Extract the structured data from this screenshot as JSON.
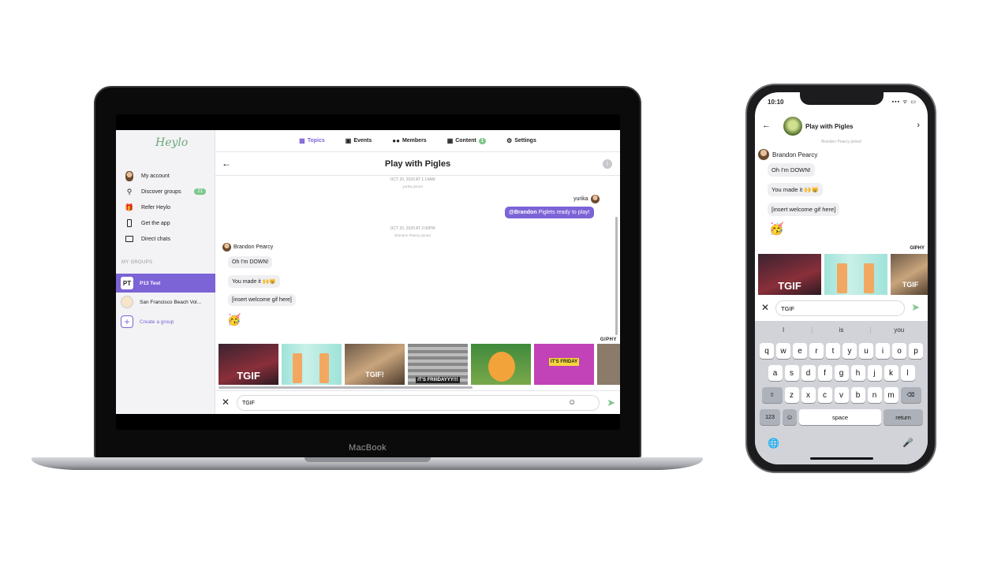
{
  "laptop": {
    "brand_label": "MacBook",
    "app": {
      "logo": "Heylo",
      "sidebar": {
        "items": [
          {
            "label": "My account",
            "icon": "avatar-icon"
          },
          {
            "label": "Discover groups",
            "icon": "search-icon",
            "badge": "21"
          },
          {
            "label": "Refer Heylo",
            "icon": "gift-icon"
          },
          {
            "label": "Get the app",
            "icon": "phone-icon"
          },
          {
            "label": "Direct chats",
            "icon": "chat-icon"
          }
        ],
        "groups_heading": "MY GROUPS",
        "groups": [
          {
            "initials": "PT",
            "label": "P13 Test",
            "active": true
          },
          {
            "label": "San Francisco Beach Vol...",
            "active": false
          },
          {
            "label": "Create a group",
            "active": false
          }
        ]
      },
      "tabs": [
        {
          "label": "Topics",
          "icon": "chat-bubble-icon",
          "active": true
        },
        {
          "label": "Events",
          "icon": "calendar-icon"
        },
        {
          "label": "Members",
          "icon": "people-icon"
        },
        {
          "label": "Content",
          "icon": "grid-icon",
          "badge": "1"
        },
        {
          "label": "Settings",
          "icon": "gear-icon"
        }
      ],
      "chat": {
        "title": "Play with Pigles",
        "meta1_date": "OCT 20, 2020 AT 1:14AM",
        "meta1_event": "yurika joined",
        "me_name": "yurika",
        "me_mention": "@Brandon",
        "me_message": "Piglets ready to play!",
        "meta2_date": "OCT 20, 2020 AT 2:00PM",
        "meta2_event": "Brandon Pearcy joined",
        "sender": "Brandon Pearcy",
        "messages": [
          "Oh I'm DOWN!",
          "You made it 🙌😸",
          "[insert welcome gif here]"
        ],
        "emoji": "🥳",
        "giphy_label": "GIPHY",
        "gif_captions": [
          "TGIF",
          "",
          "TGIF!",
          "IT'S FRIIIDAYYY!!!",
          "",
          "IT'S FRIDAY",
          ""
        ]
      },
      "composer": {
        "value": "TGIF"
      }
    }
  },
  "phone": {
    "time": "10:10",
    "status_icons": "▪▪▪ ᯤ ▭",
    "title": "Play with Pigles",
    "meta": "Brandon Pearcy joined",
    "sender": "Brandon Pearcy",
    "messages": [
      "Oh I'm DOWN!",
      "You made it 🙌😸",
      "[insert welcome gif here]"
    ],
    "emoji": "🥳",
    "giphy_label": "GIPHY",
    "gif_captions": [
      "TGIF",
      "",
      "TGIF"
    ],
    "composer_value": "TGIF",
    "suggestions": [
      "I",
      "is",
      "you"
    ],
    "keyboard": {
      "row1": [
        "q",
        "w",
        "e",
        "r",
        "t",
        "y",
        "u",
        "i",
        "o",
        "p"
      ],
      "row2": [
        "a",
        "s",
        "d",
        "f",
        "g",
        "h",
        "j",
        "k",
        "l"
      ],
      "row3": [
        "z",
        "x",
        "c",
        "v",
        "b",
        "n",
        "m"
      ],
      "numbers_key": "123",
      "space_key": "space",
      "return_key": "return"
    }
  },
  "colors": {
    "accent": "#7c63d6",
    "green": "#7cc78c"
  }
}
